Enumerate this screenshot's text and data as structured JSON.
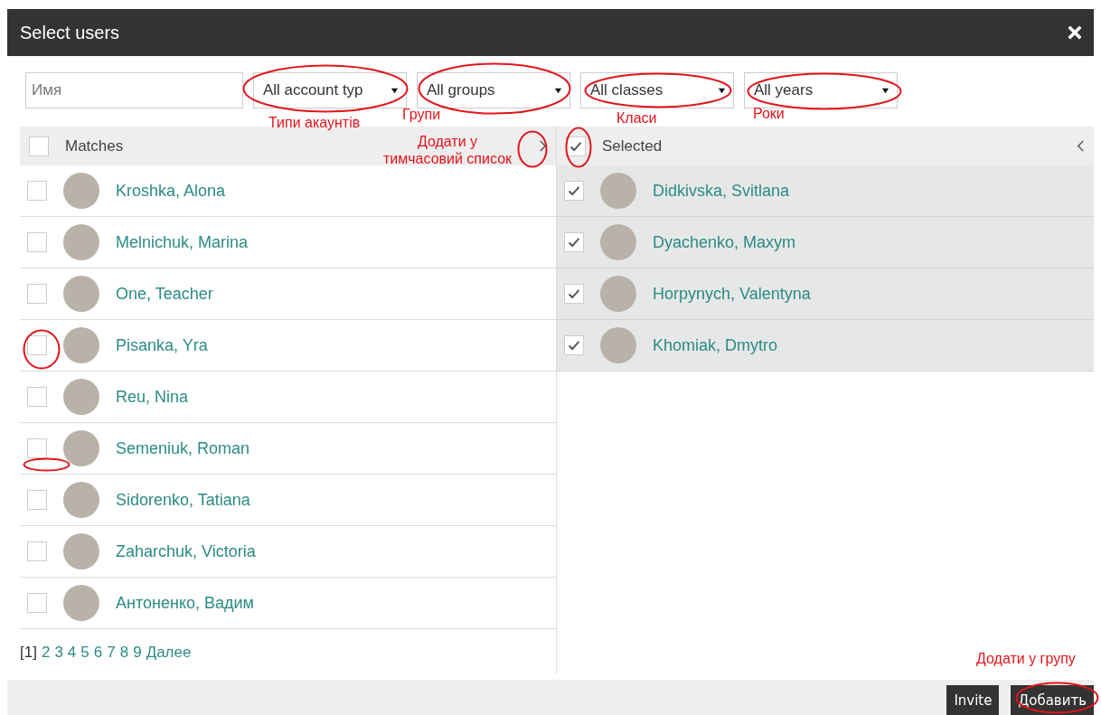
{
  "dialog": {
    "title": "Select users"
  },
  "filters": {
    "name_field": {
      "placeholder": "Имя"
    },
    "selects": [
      "All account typ",
      "All groups",
      "All classes",
      "All years"
    ]
  },
  "matches": {
    "label": "Matches",
    "checked": false,
    "users": [
      {
        "name": "Kroshka, Alona",
        "checked": false
      },
      {
        "name": "Melnichuk, Marina",
        "checked": false
      },
      {
        "name": "One, Teacher",
        "checked": false
      },
      {
        "name": "Pisanka, Yra",
        "checked": false
      },
      {
        "name": "Reu, Nina",
        "checked": false
      },
      {
        "name": "Semeniuk, Roman",
        "checked": false
      },
      {
        "name": "Sidorenko, Tatiana",
        "checked": false
      },
      {
        "name": "Zaharchuk, Victoria",
        "checked": false
      },
      {
        "name": "Антоненко, Вадим",
        "checked": false
      }
    ]
  },
  "selected": {
    "label": "Selected",
    "checked": true,
    "users": [
      {
        "name": "Didkivska, Svitlana",
        "checked": true
      },
      {
        "name": "Dyachenko, Maxym",
        "checked": true
      },
      {
        "name": "Horpynych, Valentyna",
        "checked": true
      },
      {
        "name": "Khomiak, Dmytro",
        "checked": true
      }
    ]
  },
  "pagination": {
    "current": "[1]",
    "pages": [
      "2",
      "3",
      "4",
      "5",
      "6",
      "7",
      "8",
      "9"
    ],
    "next": "Далее"
  },
  "buttons": [
    "Invite",
    "Добавить"
  ],
  "annotations": [
    "Типи акаунтів",
    "Групи",
    "Класи",
    "Роки",
    "Додати у тимчасовий список",
    "Додати у групу"
  ]
}
